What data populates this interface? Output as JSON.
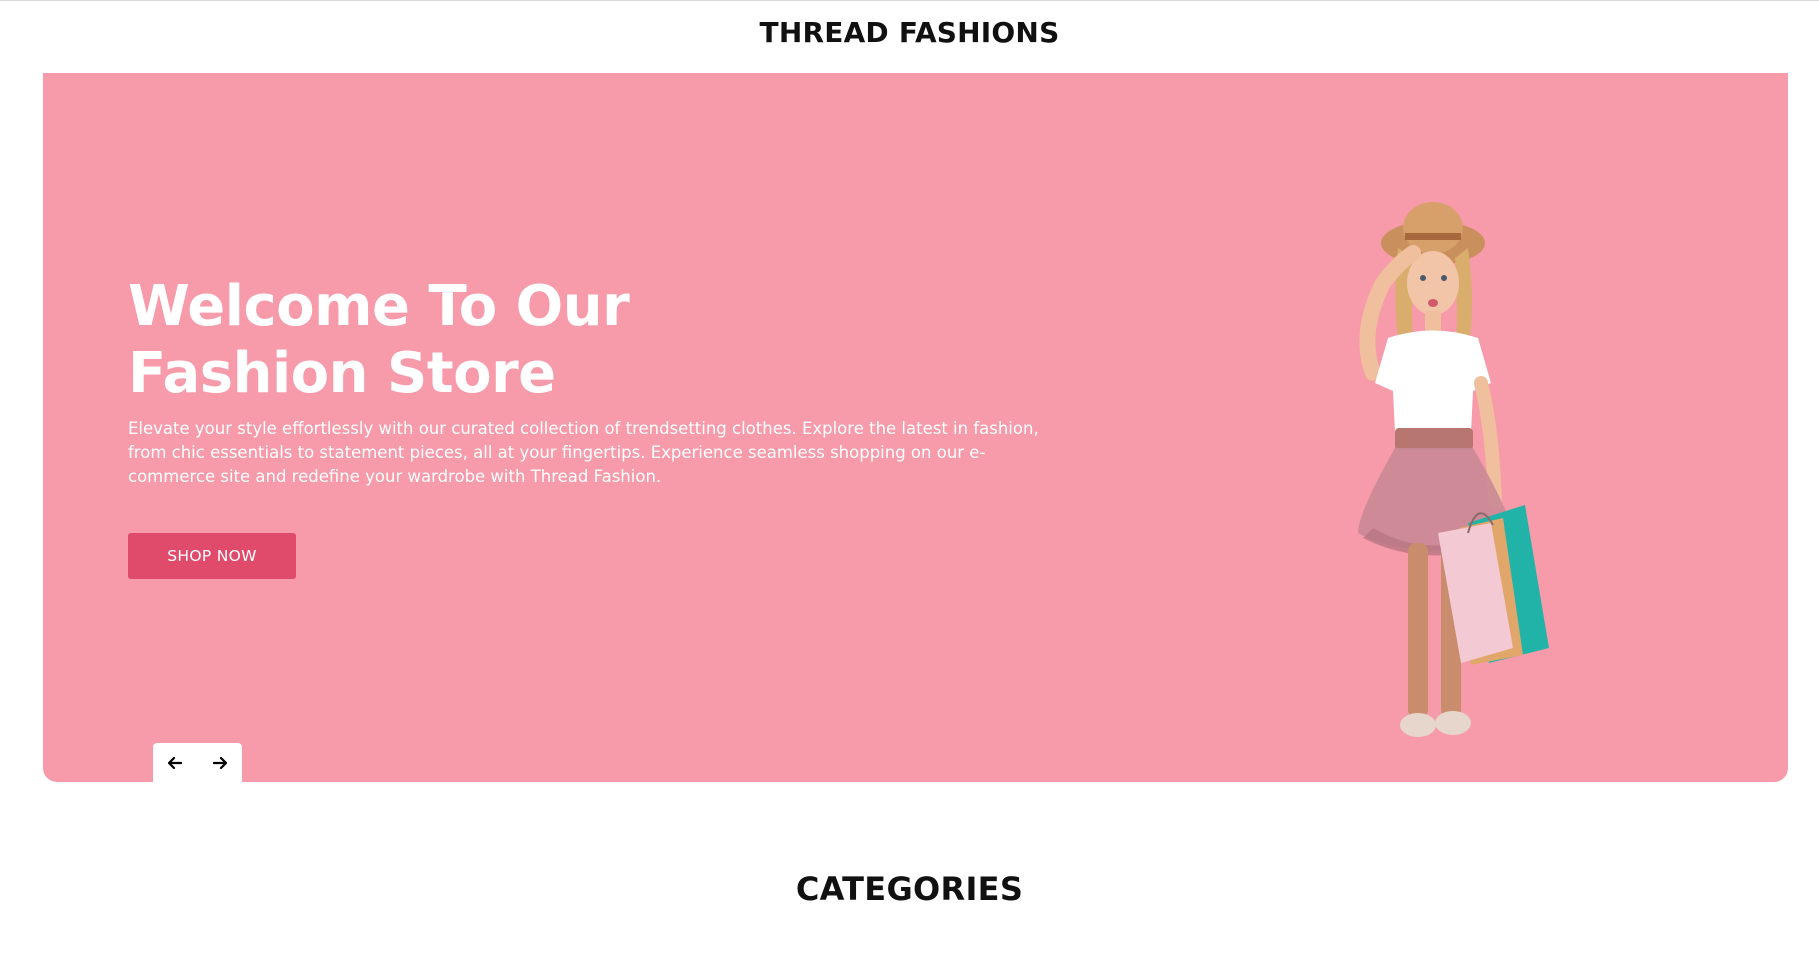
{
  "header": {
    "site_title": "THREAD FASHIONS"
  },
  "hero": {
    "heading_line1": "Welcome To Our",
    "heading_line2": "Fashion Store",
    "description": "Elevate your style effortlessly with our curated collection of trendsetting clothes. Explore the latest in fashion, from chic essentials to statement pieces, all at your fingertips. Experience seamless shopping on our e-commerce site and redefine your wardrobe with Thread Fashion.",
    "cta_label": "SHOP NOW",
    "background_color": "#f79aaa",
    "cta_color": "#e04a6b"
  },
  "slider": {
    "prev_icon": "arrow-left-icon",
    "next_icon": "arrow-right-icon"
  },
  "sections": {
    "categories_title": "CATEGORIES"
  }
}
